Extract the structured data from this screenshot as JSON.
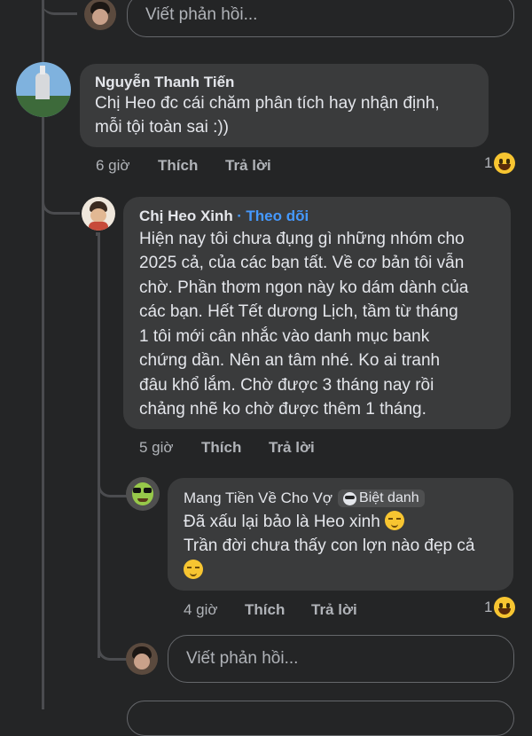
{
  "top_reply": {
    "placeholder": "Viết phản hồi..."
  },
  "comment1": {
    "author": "Nguyễn Thanh Tiến",
    "lines": [
      "Chị Heo đc cái chăm phân tích hay nhận định,",
      "mỗi tội toàn sai :))"
    ],
    "time": "6 giờ",
    "like": "Thích",
    "reply": "Trả lời",
    "reaction_count": "1"
  },
  "comment2": {
    "author": "Chị Heo Xinh",
    "follow_sep": "·",
    "follow": "Theo dõi",
    "lines": [
      "Hiện nay tôi chưa đụng gì những nhóm cho",
      "2025 cả, của các bạn tất. Về cơ bản tôi vẫn",
      "chờ. Phần thơm ngon này ko dám dành của",
      "các bạn. Hết Tết dương Lịch, tầm từ tháng",
      "1 tôi mới cân nhắc vào danh mục bank",
      "chứng dần. Nên an tâm nhé. Ko ai tranh",
      "đâu khổ lắm. Chờ được 3 tháng nay rồi",
      "chảng nhẽ ko chờ được thêm 1 tháng."
    ],
    "time": "5 giờ",
    "like": "Thích",
    "reply": "Trả lời"
  },
  "comment3": {
    "author": "Mang Tiền Về Cho Vợ",
    "badge": "Biệt danh",
    "line1": "Đã xấu lại bảo là Heo xinh",
    "line2": "Trần đời chưa thấy con lợn nào đẹp cả",
    "time": "4 giờ",
    "like": "Thích",
    "reply": "Trả lời",
    "reaction_count": "1"
  },
  "bottom_reply": {
    "placeholder": "Viết phản hồi..."
  },
  "colors": {
    "background": "#242526",
    "bubble": "#3a3b3c",
    "link": "#4599ff",
    "secondary": "#b0b3b8"
  },
  "icons": {
    "reaction": "laughing-emoji-icon",
    "inline_emoji": "relieved-emoji-icon",
    "badge": "sunglasses-emoji-icon"
  }
}
